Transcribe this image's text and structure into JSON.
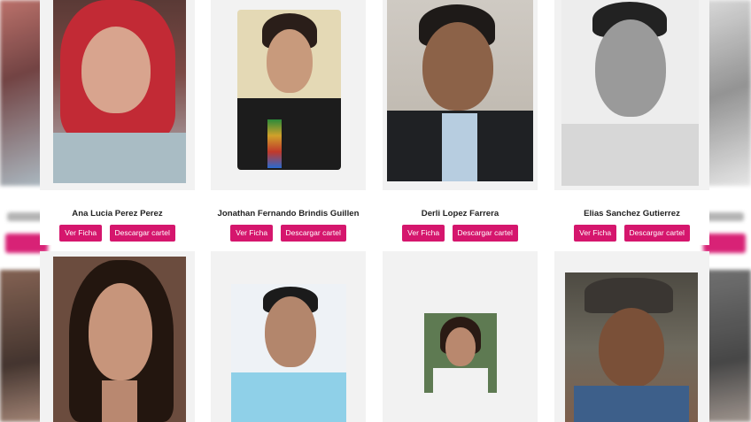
{
  "persons_row1": [
    {
      "name": "Ana Lucia Perez Perez",
      "view_label": "Ver Ficha",
      "download_label": "Descargar cartel"
    },
    {
      "name": "Jonathan Fernando Brindis Guillen",
      "view_label": "Ver Ficha",
      "download_label": "Descargar cartel"
    },
    {
      "name": "Derli Lopez Farrera",
      "view_label": "Ver Ficha",
      "download_label": "Descargar cartel"
    },
    {
      "name": "Elias Sanchez Gutierrez",
      "view_label": "Ver Ficha",
      "download_label": "Descargar cartel"
    }
  ],
  "colors": {
    "button": "#d5166d",
    "card_bg": "#f2f2f2",
    "name_bg": "#ffffff"
  }
}
